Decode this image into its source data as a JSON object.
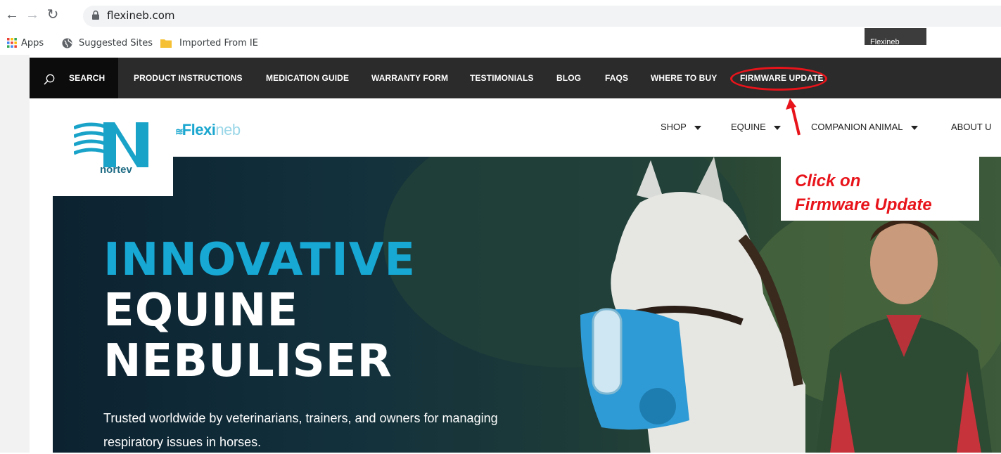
{
  "browser": {
    "url": "flexineb.com",
    "bookmarks": [
      {
        "label": "Apps",
        "icon": "apps-grid-icon"
      },
      {
        "label": "Suggested Sites",
        "icon": "globe-icon"
      },
      {
        "label": "Imported From IE",
        "icon": "folder-icon"
      }
    ],
    "tooltip": "Flexineb"
  },
  "topbar": {
    "search_label": "SEARCH",
    "links": [
      "PRODUCT INSTRUCTIONS",
      "MEDICATION GUIDE",
      "WARRANTY FORM",
      "TESTIMONIALS",
      "BLOG",
      "FAQS",
      "WHERE TO BUY",
      "FIRMWARE UPDATE"
    ]
  },
  "brand": {
    "nortev": "nortev",
    "flexineb_bold": "Flexi",
    "flexineb_thin": "neb"
  },
  "main_nav": {
    "items": [
      "SHOP",
      "EQUINE",
      "COMPANION ANIMAL",
      "ABOUT U"
    ]
  },
  "hero": {
    "line1": "INNOVATIVE",
    "line2": "EQUINE",
    "line3": "NEBULISER",
    "subtitle": "Trusted worldwide by veterinarians, trainers, and owners for managing respiratory issues in horses.",
    "accent_color": "#17a8d4"
  },
  "annotation": {
    "line1": "Click on",
    "line2": "Firmware Update",
    "color": "#e8141b"
  }
}
